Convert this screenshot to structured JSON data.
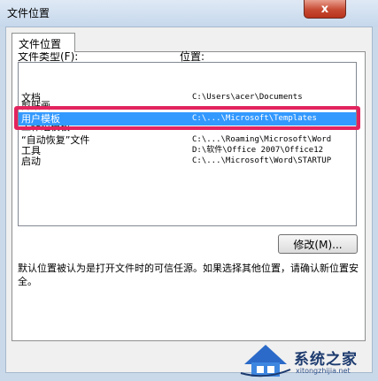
{
  "window": {
    "title": "文件位置",
    "close_label": "x"
  },
  "tab": {
    "label": "文件位置"
  },
  "columns": {
    "type_label": "文件类型(F):",
    "location_label": "位置:"
  },
  "rows": [
    {
      "type": "文档",
      "location": "C:\\Users\\acer\\Documents",
      "selected": false
    },
    {
      "type": "剪贴画",
      "location": "",
      "selected": false
    },
    {
      "type": "用户模板",
      "location": "C:\\...\\Microsoft\\Templates",
      "selected": true
    },
    {
      "type": "工作组模板",
      "location": "",
      "selected": false
    },
    {
      "type": "“自动恢复”文件",
      "location": "C:\\...\\Roaming\\Microsoft\\Word",
      "selected": false
    },
    {
      "type": "工具",
      "location": "D:\\软件\\Office 2007\\Office12",
      "selected": false
    },
    {
      "type": "启动",
      "location": "C:\\...\\Microsoft\\Word\\STARTUP",
      "selected": false
    }
  ],
  "modify_button": {
    "label": "修改(M)..."
  },
  "description": "默认位置被认为是打开文件时的可信任源。如果选择其他位置，请确认新位置安全。",
  "watermark": {
    "text": "系统之家",
    "url": "xitongzhijia.net"
  },
  "colors": {
    "selection": "#3399ff",
    "highlight": "#e2245e",
    "close_button": "#c74a33"
  }
}
